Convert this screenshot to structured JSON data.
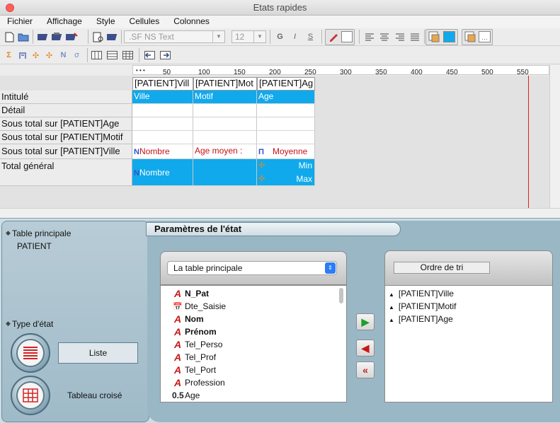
{
  "window": {
    "title": "Etats rapides"
  },
  "menu": [
    "Fichier",
    "Affichage",
    "Style",
    "Cellules",
    "Colonnes"
  ],
  "toolbar": {
    "font_name": ".SF NS Text",
    "font_size": "12"
  },
  "ruler": {
    "ticks": [
      "50",
      "100",
      "150",
      "200",
      "250",
      "300",
      "350",
      "400",
      "450",
      "500",
      "550"
    ]
  },
  "grid": {
    "headers": [
      "[PATIENT]Vill",
      "[PATIENT]Mot",
      "[PATIENT]Ag"
    ],
    "rows": [
      {
        "label": "Intitulé",
        "cells": [
          "Ville",
          "Motif",
          "Age"
        ]
      },
      {
        "label": "Détail",
        "cells": [
          "",
          "",
          ""
        ]
      },
      {
        "label": "Sous total sur [PATIENT]Age",
        "cells": [
          "",
          "",
          ""
        ]
      },
      {
        "label": "Sous total sur [PATIENT]Motif",
        "cells": [
          "",
          "",
          ""
        ]
      },
      {
        "label": "Sous total sur [PATIENT]Ville",
        "cells": [
          "Nombre",
          "Age moyen :",
          "Moyenne"
        ]
      },
      {
        "label": "Total général",
        "cells": [
          "Nombre",
          "",
          "Min",
          "Max"
        ]
      }
    ]
  },
  "left_panel": {
    "table_principale_label": "Table principale",
    "table_name": "PATIENT",
    "type_label": "Type d'état",
    "liste_label": "Liste",
    "tableau_label": "Tableau croisé"
  },
  "params": {
    "title": "Paramètres de l'état",
    "table_select": "La table principale",
    "fields": [
      {
        "name": "N_Pat",
        "icon": "alpha-icon",
        "bold": true
      },
      {
        "name": "Dte_Saisie",
        "icon": "calendar-icon",
        "bold": false
      },
      {
        "name": "Nom",
        "icon": "alpha-icon",
        "bold": true
      },
      {
        "name": "Prénom",
        "icon": "alpha-icon",
        "bold": true
      },
      {
        "name": "Tel_Perso",
        "icon": "alpha-icon",
        "bold": false
      },
      {
        "name": "Tel_Prof",
        "icon": "alpha-icon",
        "bold": false
      },
      {
        "name": "Tel_Port",
        "icon": "alpha-icon",
        "bold": false
      },
      {
        "name": "Profession",
        "icon": "alpha-icon",
        "bold": false
      },
      {
        "name": "Age",
        "icon": "real-icon",
        "bold": false
      }
    ],
    "sort_label": "Ordre de tri",
    "sort_items": [
      "[PATIENT]Ville",
      "[PATIENT]Motif",
      "[PATIENT]Age"
    ],
    "real_icon_text": "0.5"
  }
}
